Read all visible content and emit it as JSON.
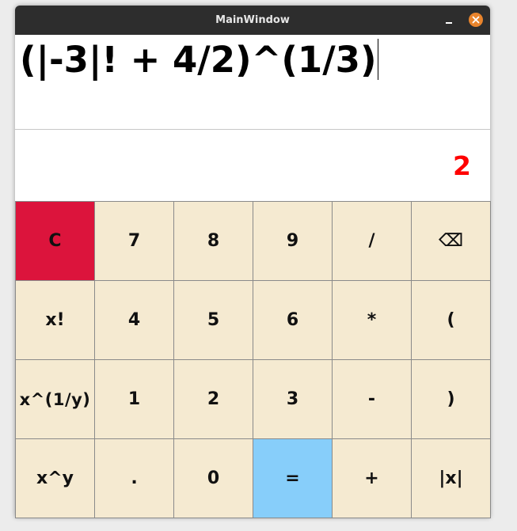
{
  "window": {
    "title": "MainWindow"
  },
  "display": {
    "expression": "(|-3|! + 4/2)^(1/3)",
    "result": "2"
  },
  "keys": [
    {
      "name": "clear-button",
      "label": "C"
    },
    {
      "name": "digit-7-button",
      "label": "7"
    },
    {
      "name": "digit-8-button",
      "label": "8"
    },
    {
      "name": "digit-9-button",
      "label": "9"
    },
    {
      "name": "divide-button",
      "label": "/"
    },
    {
      "name": "backspace-button",
      "label": "⌫"
    },
    {
      "name": "factorial-button",
      "label": "x!"
    },
    {
      "name": "digit-4-button",
      "label": "4"
    },
    {
      "name": "digit-5-button",
      "label": "5"
    },
    {
      "name": "digit-6-button",
      "label": "6"
    },
    {
      "name": "multiply-button",
      "label": "*"
    },
    {
      "name": "open-paren-button",
      "label": "("
    },
    {
      "name": "root-button",
      "label": "x^(1/y)"
    },
    {
      "name": "digit-1-button",
      "label": "1"
    },
    {
      "name": "digit-2-button",
      "label": "2"
    },
    {
      "name": "digit-3-button",
      "label": "3"
    },
    {
      "name": "subtract-button",
      "label": "-"
    },
    {
      "name": "close-paren-button",
      "label": ")"
    },
    {
      "name": "power-button",
      "label": "x^y"
    },
    {
      "name": "decimal-point-button",
      "label": "."
    },
    {
      "name": "digit-0-button",
      "label": "0"
    },
    {
      "name": "equals-button",
      "label": "="
    },
    {
      "name": "add-button",
      "label": "+"
    },
    {
      "name": "absolute-value-button",
      "label": "|x|"
    }
  ],
  "colors": {
    "key_background": "#f5ead1",
    "clear_background": "#dc143c",
    "equals_background": "#87cefa",
    "result_text": "#ff0000",
    "titlebar": "#2d2d2d",
    "close_button": "#e9842c"
  },
  "icons": {
    "minimize": "minimize-icon",
    "close": "close-icon"
  }
}
